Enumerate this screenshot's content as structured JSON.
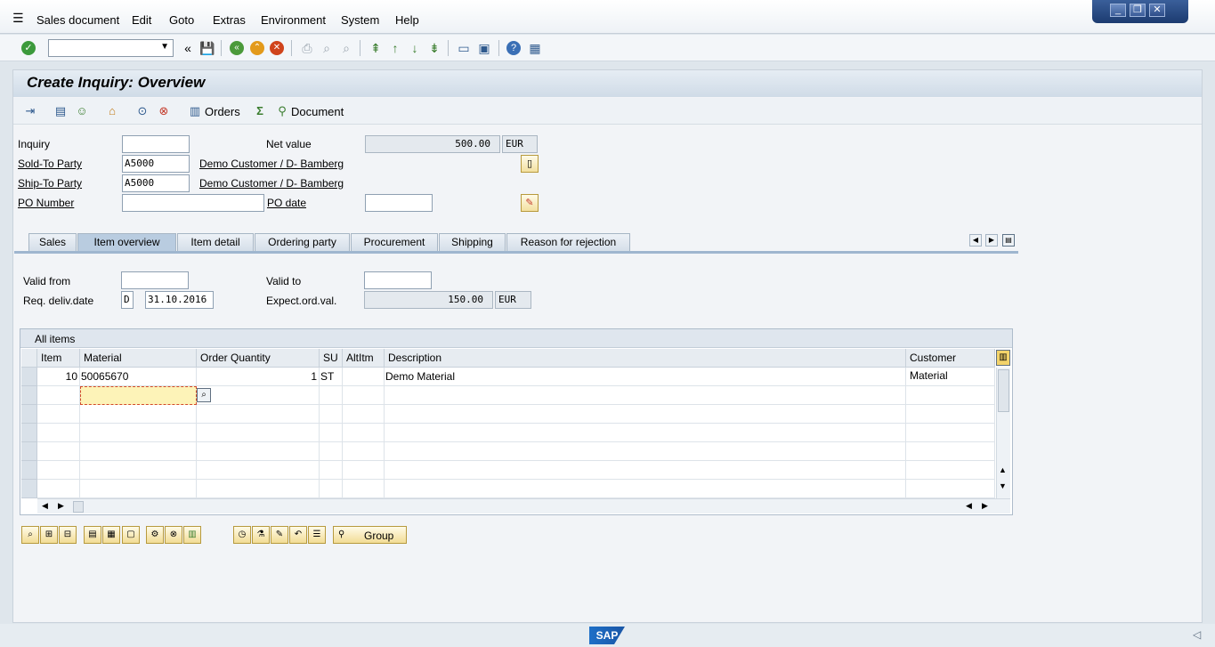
{
  "menu": {
    "items": [
      "Sales document",
      "Edit",
      "Goto",
      "Extras",
      "Environment",
      "System",
      "Help"
    ]
  },
  "toolbar": {
    "command_value": ""
  },
  "screen": {
    "title": "Create Inquiry: Overview"
  },
  "app_toolbar": {
    "orders_label": "Orders",
    "document_label": "Document"
  },
  "header": {
    "inquiry_label": "Inquiry",
    "inquiry_value": "",
    "net_value_label": "Net value",
    "net_value": "500.00",
    "net_value_currency": "EUR",
    "sold_to_label": "Sold-To Party",
    "sold_to_value": "A5000",
    "sold_to_name": "Demo Customer / D- Bamberg",
    "ship_to_label": "Ship-To Party",
    "ship_to_value": "A5000",
    "ship_to_name": "Demo Customer / D- Bamberg",
    "po_number_label": "PO Number",
    "po_number_value": "",
    "po_date_label": "PO date",
    "po_date_value": ""
  },
  "tabs": [
    {
      "label": "Sales",
      "active": false
    },
    {
      "label": "Item overview",
      "active": true
    },
    {
      "label": "Item detail",
      "active": false
    },
    {
      "label": "Ordering party",
      "active": false
    },
    {
      "label": "Procurement",
      "active": false
    },
    {
      "label": "Shipping",
      "active": false
    },
    {
      "label": "Reason for rejection",
      "active": false
    }
  ],
  "item_overview": {
    "valid_from_label": "Valid from",
    "valid_from_value": "",
    "valid_to_label": "Valid to",
    "valid_to_value": "",
    "req_deliv_label": "Req. deliv.date",
    "req_deliv_type": "D",
    "req_deliv_value": "31.10.2016",
    "expect_label": "Expect.ord.val.",
    "expect_value": "150.00",
    "expect_currency": "EUR"
  },
  "table": {
    "title": "All items",
    "columns": [
      "Item",
      "Material",
      "Order Quantity",
      "SU",
      "AltItm",
      "Description",
      "Customer Material"
    ],
    "rows": [
      {
        "item": "10",
        "material": "50065670",
        "quantity": "1",
        "su": "ST",
        "altitm": "",
        "description": "Demo Material",
        "customer_material": ""
      }
    ]
  },
  "bottom_toolbar": {
    "group_label": "Group"
  },
  "statusbar": {
    "logo": "SAP"
  },
  "colors": {
    "accent": "#1c3b70",
    "title_band": "#cfdbe7",
    "active_tab": "#b9cce0",
    "focus_cell": "#fdf3b8"
  }
}
